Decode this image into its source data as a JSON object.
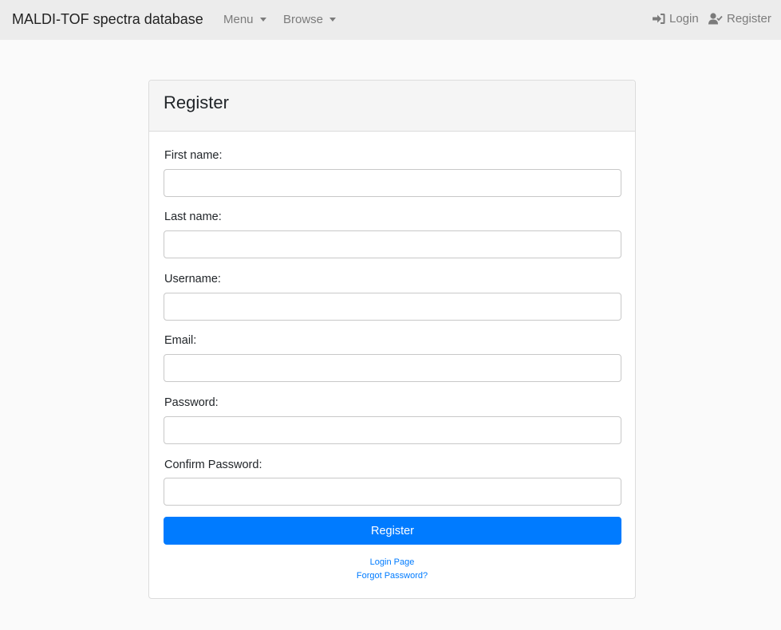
{
  "navbar": {
    "brand": "MALDI-TOF spectra database",
    "menu_label": "Menu",
    "browse_label": "Browse",
    "login_label": "Login",
    "register_label": "Register"
  },
  "form": {
    "title": "Register",
    "first_name_label": "First name:",
    "first_name_value": "",
    "last_name_label": "Last name:",
    "last_name_value": "",
    "username_label": "Username:",
    "username_value": "",
    "email_label": "Email:",
    "email_value": "",
    "password_label": "Password:",
    "password_value": "",
    "confirm_password_label": "Confirm Password:",
    "confirm_password_value": "",
    "submit_label": "Register",
    "login_page_link": "Login Page",
    "forgot_password_link": "Forgot Password?"
  },
  "colors": {
    "accent": "#007bff",
    "navbar_bg": "#ececec",
    "page_bg": "#fafafa",
    "nav_text": "#7b7b7b"
  },
  "icons": {
    "login": "sign-in-icon",
    "register": "user-check-icon"
  }
}
